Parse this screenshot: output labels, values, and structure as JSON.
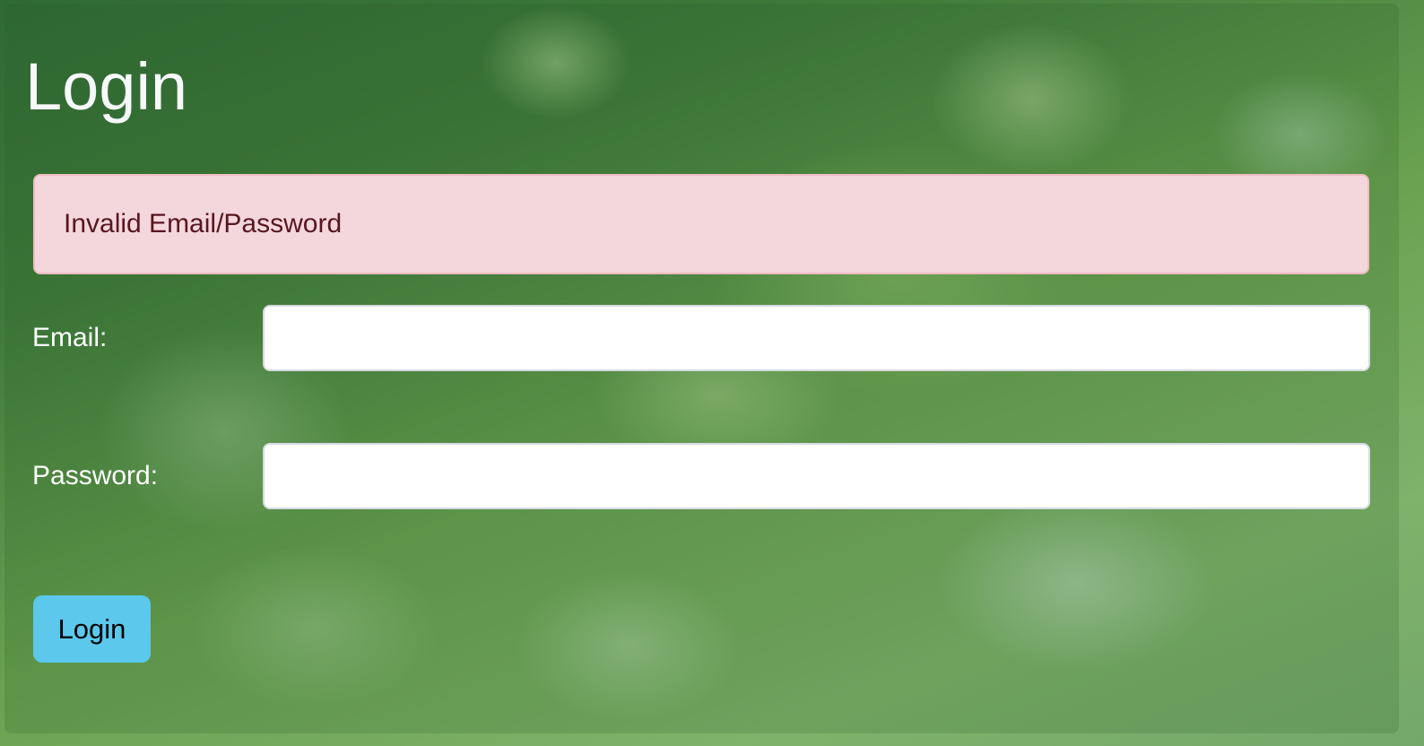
{
  "page": {
    "title": "Login"
  },
  "alert": {
    "message": "Invalid Email/Password",
    "type": "danger"
  },
  "form": {
    "email_label": "Email:",
    "email_value": "",
    "password_label": "Password:",
    "password_value": "",
    "submit_label": "Login"
  },
  "colors": {
    "alert_bg": "#f4d7dc",
    "alert_text": "#58161f",
    "button_bg": "#5bc8ec"
  }
}
